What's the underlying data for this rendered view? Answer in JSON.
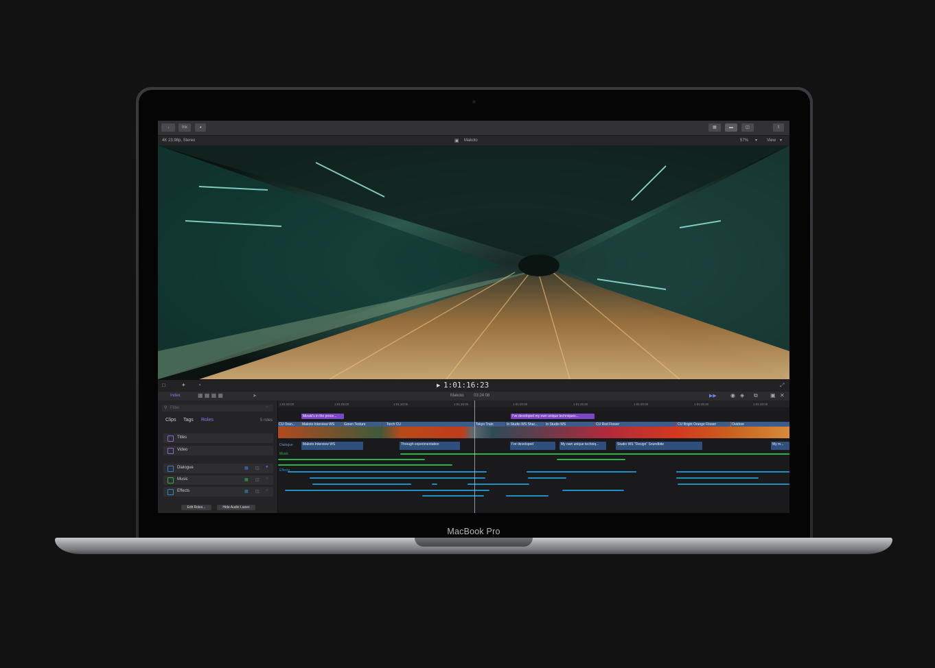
{
  "device": {
    "brand_label": "MacBook Pro"
  },
  "app": {
    "toolbar": {
      "button_2": "lnx"
    },
    "viewer": {
      "format_info": "4K 23.98p, Stereo",
      "clip_title": "Makoto",
      "zoom": "57%",
      "view_menu": "View"
    },
    "transport": {
      "timecode": "1:01:16:23"
    },
    "timeline_header": {
      "index_tab": "Index",
      "project_name": "Makoto",
      "duration": "03:24:08"
    },
    "index": {
      "search_placeholder": "Filter",
      "tabs": [
        "Clips",
        "Tags",
        "Roles"
      ],
      "active_tab": "Roles",
      "roles_count": "5 roles",
      "roles": [
        "Titles",
        "Video",
        "Dialogue",
        "Music",
        "Effects"
      ],
      "edit_roles_button": "Edit Roles...",
      "hide_audio_lanes_button": "Hide Audio Lanes"
    },
    "ruler_ticks": [
      "1:01:00:00",
      "1:01:05:00",
      "1:01:10:00",
      "1:01:15:00",
      "1:01:20:00",
      "1:01:25:00",
      "1:01:30:00",
      "1:01:35:00",
      "1:01:40:00"
    ],
    "title_clips": [
      "Mizuki's in the proce...",
      "I've developed my own unique techniques..."
    ],
    "video_clips": [
      "CU Oran...",
      "Makoto Interview WS",
      "Green Texture",
      "Torch CU",
      "Tokyo Train",
      "In Studio WS Shar...",
      "In Studio WS",
      "CU Red Flower",
      "CU Bright Orange Flower",
      "Outdoor"
    ],
    "dialogue_role": "Dialogue",
    "dialogue_clips": [
      "Makoto Interview WS",
      "Through experimentation",
      "I've developed",
      "My own unique techniq...",
      "Studio WS \"Design\" Soundbite",
      "My m..."
    ],
    "music_role": "Music",
    "effects_role": "Effects"
  },
  "colors": {
    "accent": "#7d5fd6",
    "video_clip": "#3c5d8c",
    "dialogue": "#2f4f7c",
    "music": "#2fb14a",
    "effects": "#1f8fc2",
    "title_clip": "#7d45c8"
  }
}
